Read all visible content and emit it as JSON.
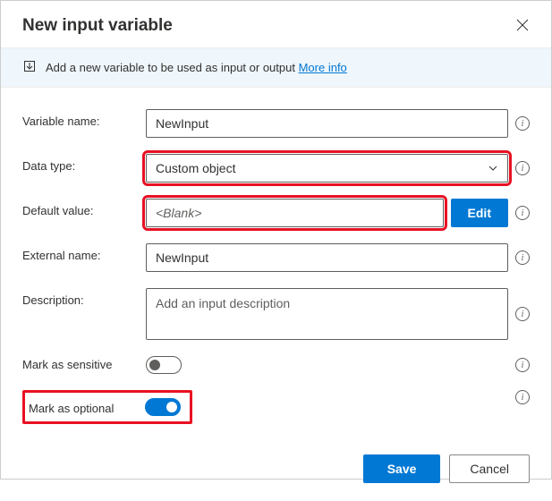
{
  "header": {
    "title": "New input variable"
  },
  "infobar": {
    "text": "Add a new variable to be used as input or output ",
    "link": "More info"
  },
  "form": {
    "variable_name": {
      "label": "Variable name:",
      "value": "NewInput"
    },
    "data_type": {
      "label": "Data type:",
      "selected": "Custom object"
    },
    "default_value": {
      "label": "Default value:",
      "value": "<Blank>",
      "edit_btn": "Edit"
    },
    "external_name": {
      "label": "External name:",
      "value": "NewInput"
    },
    "description": {
      "label": "Description:",
      "placeholder": "Add an input description"
    },
    "mark_sensitive": {
      "label": "Mark as sensitive"
    },
    "mark_optional": {
      "label": "Mark as optional"
    }
  },
  "footer": {
    "save": "Save",
    "cancel": "Cancel"
  }
}
